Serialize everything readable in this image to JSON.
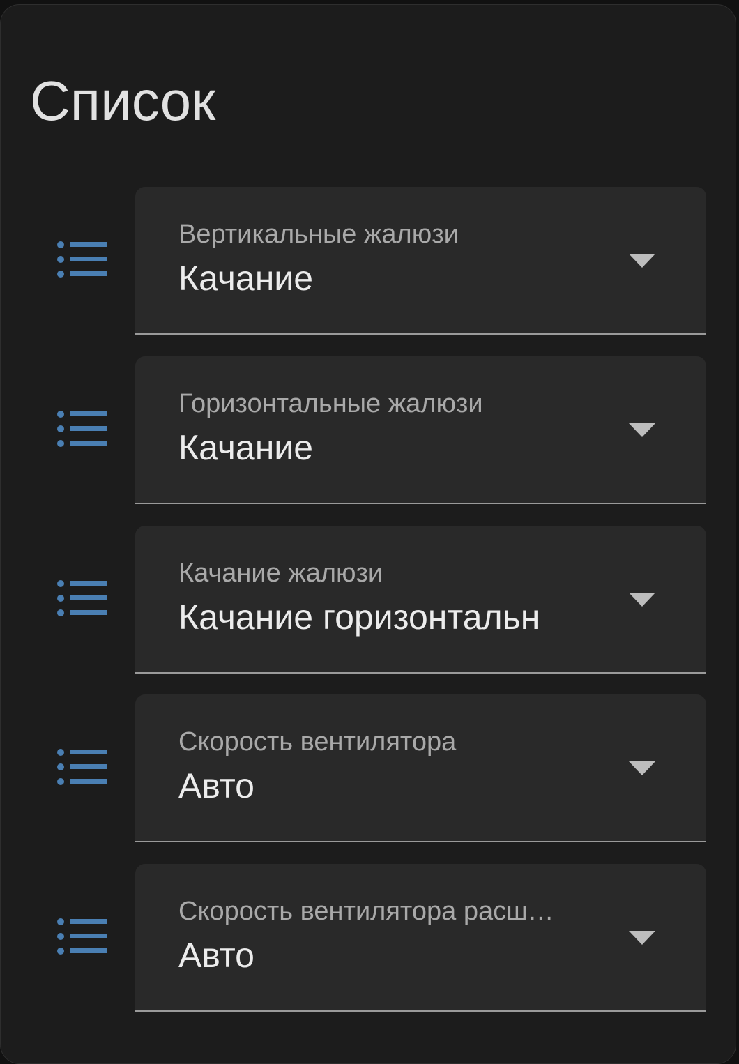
{
  "card": {
    "title": "Список"
  },
  "theme": {
    "accent": "#4a7fb3",
    "background": "#1c1c1c",
    "field_background": "#292929"
  },
  "rows": [
    {
      "icon": "format-list-bulleted-icon",
      "label": "Вертикальные жалюзи",
      "value": "Качание"
    },
    {
      "icon": "format-list-bulleted-icon",
      "label": "Горизонтальные жалюзи",
      "value": "Качание"
    },
    {
      "icon": "format-list-bulleted-icon",
      "label": "Качание жалюзи",
      "value": "Качание горизонтальн"
    },
    {
      "icon": "format-list-bulleted-icon",
      "label": "Скорость вентилятора",
      "value": "Авто"
    },
    {
      "icon": "format-list-bulleted-icon",
      "label": "Скорость вентилятора расш…",
      "value": "Авто"
    }
  ]
}
